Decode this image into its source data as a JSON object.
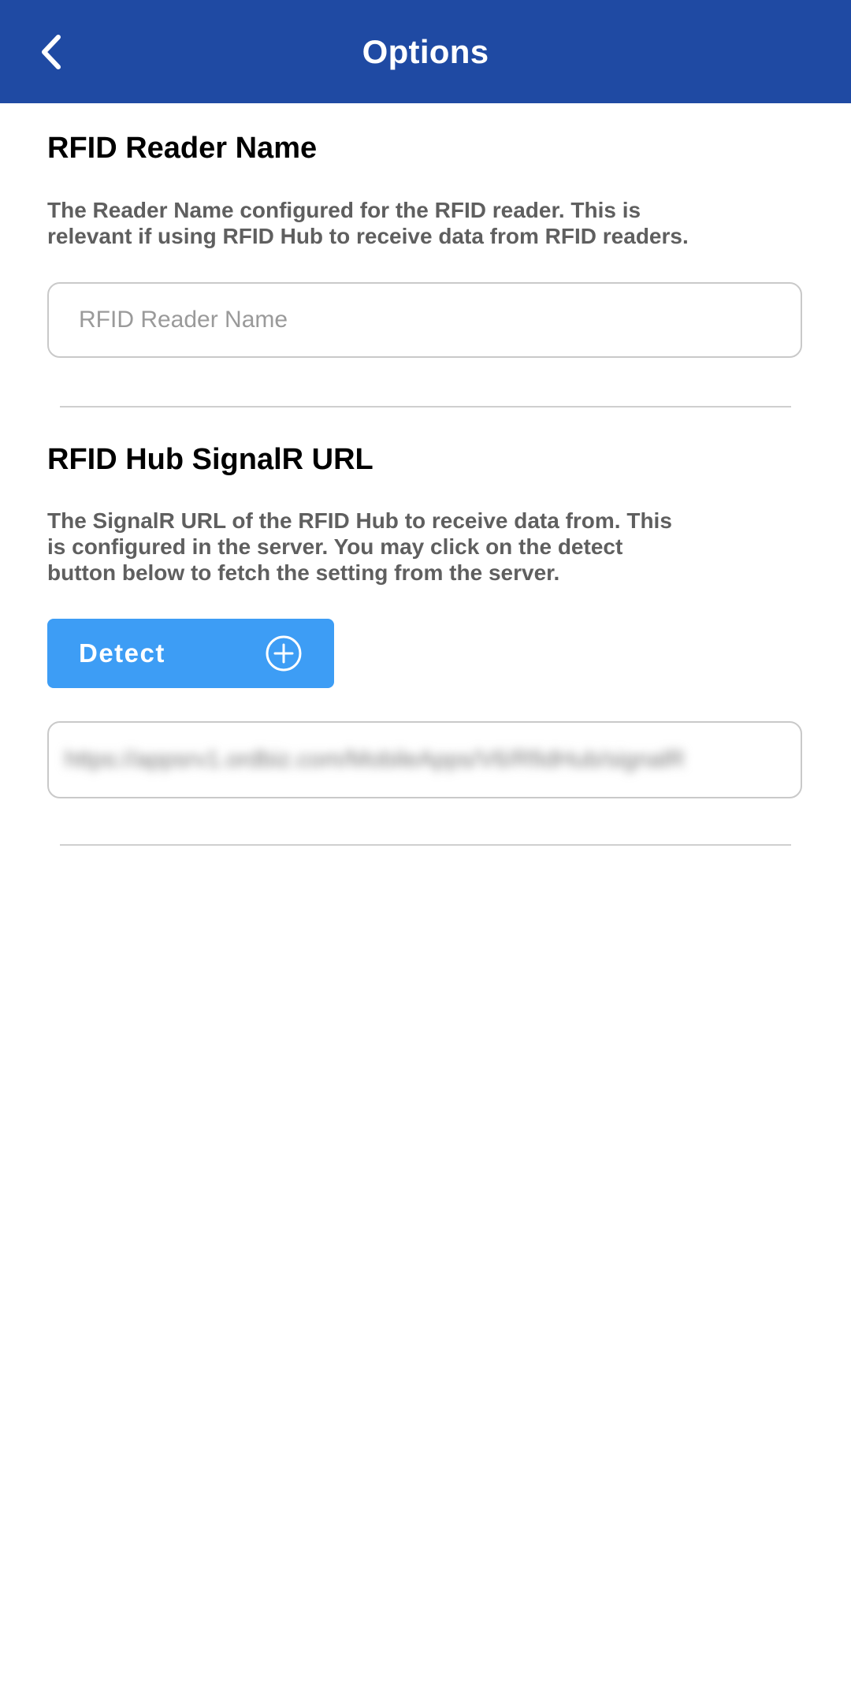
{
  "header": {
    "title": "Options",
    "back_icon": "chevron-left-icon",
    "background": "#1f4aa3"
  },
  "reader_name_section": {
    "title": "RFID Reader Name",
    "description": "The Reader Name configured for the RFID reader. This is relevant if using RFID Hub to receive data from RFID readers.",
    "input_value": "",
    "input_placeholder": "RFID Reader Name"
  },
  "signalr_section": {
    "title": "RFID Hub SignalR URL",
    "description": "The SignalR URL of the RFID Hub to receive data from. This is configured in the server. You may click on the detect button below to fetch the setting from the server.",
    "detect_button": {
      "label": "Detect",
      "icon": "plus-circle-icon",
      "background": "#3d9df5"
    },
    "url_value": "https://appsrv1.ordbiz.com/MobileApps/V6/RfidHub/signalR"
  }
}
